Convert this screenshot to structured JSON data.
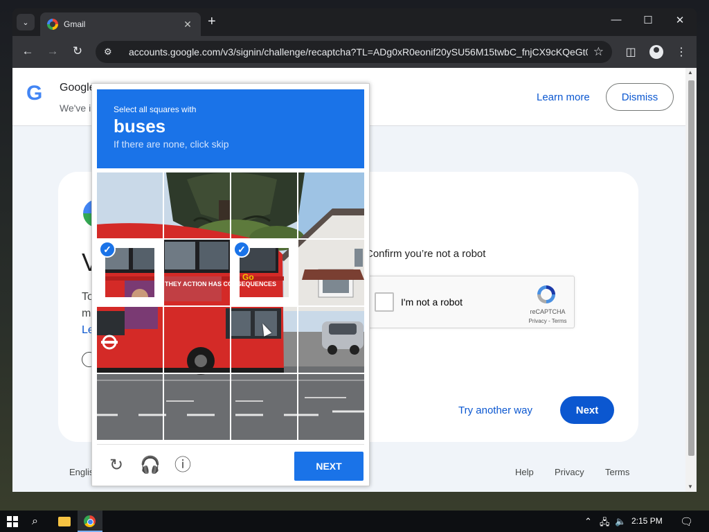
{
  "browser": {
    "tab_title": "Gmail",
    "tab_close": "✕",
    "new_tab": "+",
    "url_host": "accounts.google.com",
    "url_path": "/v3/signin/challenge/recaptcha?TL=ADg0xR0eonif20ySU56M15twbC_fnjCX9cKQeGt0...",
    "window_controls": [
      "—",
      "☐",
      "✕"
    ]
  },
  "banner": {
    "logo": "G",
    "title": "Google",
    "subtitle": "We've i",
    "learn_more": "Learn more",
    "dismiss": "Dismiss"
  },
  "card": {
    "heading": "V",
    "text1": "To",
    "text2": "m",
    "link": "Le",
    "confirm_text": "Confirm you’re not a robot",
    "try_another": "Try another way",
    "next": "Next"
  },
  "recaptcha": {
    "checkbox_label": "I'm not a robot",
    "brand": "reCAPTCHA",
    "links": "Privacy - Terms"
  },
  "challenge": {
    "instruction": "Select all squares with",
    "target": "buses",
    "skip_hint": "If there are none, click skip",
    "next_button": "NEXT",
    "bus_banner_text": "THEY ACTION HAS CONSEQUENCES",
    "selected_tiles": [
      4,
      6
    ]
  },
  "footer": {
    "language": "Englis",
    "help": "Help",
    "privacy": "Privacy",
    "terms": "Terms"
  },
  "taskbar": {
    "time": "2:15 PM"
  }
}
